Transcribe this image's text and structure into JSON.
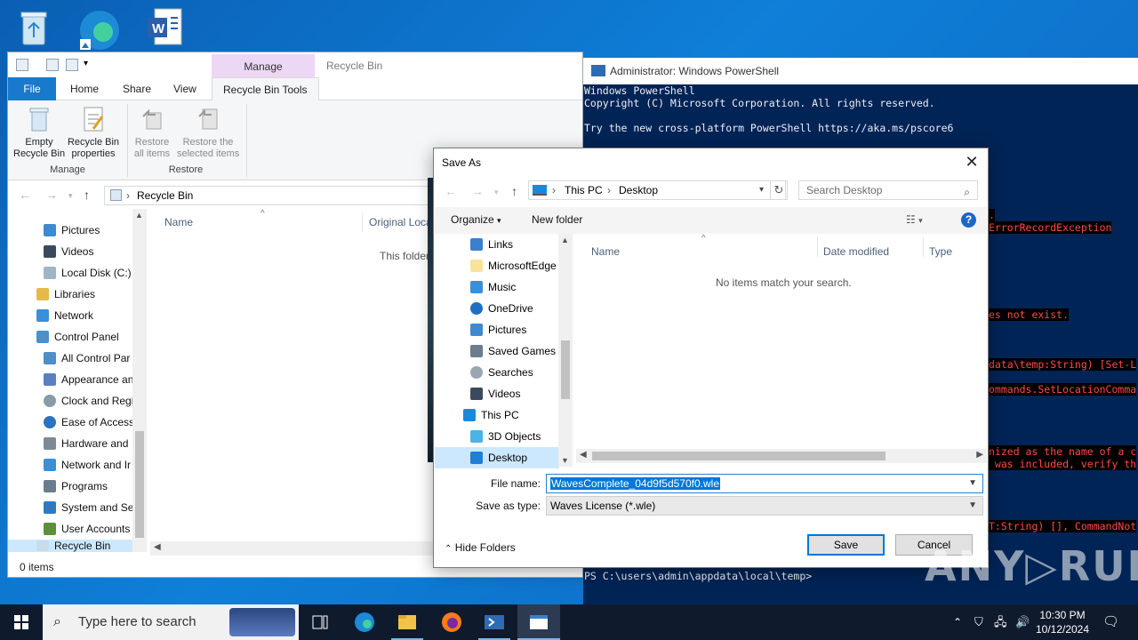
{
  "desktop": {
    "icons": [
      "recycle-bin-icon",
      "edge-icon",
      "word-icon"
    ]
  },
  "explorer": {
    "title": "Recycle Bin",
    "manage_tab": "Manage",
    "tabs": [
      "File",
      "Home",
      "Share",
      "View",
      "Recycle Bin Tools"
    ],
    "ribbon": {
      "empty": "Empty\nRecycle Bin",
      "properties": "Recycle Bin\nproperties",
      "restore_all": "Restore\nall items",
      "restore_selected": "Restore the\nselected items",
      "group_manage": "Manage",
      "group_restore": "Restore"
    },
    "address": "Recycle Bin",
    "tree": [
      "Pictures",
      "Videos",
      "Local Disk (C:)",
      "Libraries",
      "Network",
      "Control Panel",
      "All Control Par",
      "Appearance an",
      "Clock and Regi",
      "Ease of Access",
      "Hardware and",
      "Network and Ir",
      "Programs",
      "System and Se",
      "User Accounts",
      "Recycle Bin"
    ],
    "columns": [
      "Name",
      "Original Loca"
    ],
    "empty_message": "This folder",
    "status": "0 items"
  },
  "powershell": {
    "title": "Administrator: Windows PowerShell",
    "lines": [
      "Windows PowerShell",
      "Copyright (C) Microsoft Corporation. All rights reserved.",
      "",
      "Try the new cross-platform PowerShell https://aka.ms/pscore6"
    ],
    "errors": [
      ".",
      "ErrorRecordException",
      "es not exist.",
      "data\\temp:String) [Set-L",
      "ommands.SetLocationComma",
      "nized as the name of a c",
      " was included, verify th",
      "T:String) [], CommandNot"
    ],
    "prompt": "PS C:\\users\\admin\\appdata\\local\\temp>"
  },
  "dialog": {
    "title": "Save As",
    "breadcrumb": [
      "This PC",
      "Desktop"
    ],
    "search_placeholder": "Search Desktop",
    "organize": "Organize",
    "new_folder": "New folder",
    "tree": [
      "Links",
      "MicrosoftEdge",
      "Music",
      "OneDrive",
      "Pictures",
      "Saved Games",
      "Searches",
      "Videos",
      "This PC",
      "3D Objects",
      "Desktop"
    ],
    "columns": [
      "Name",
      "Date modified",
      "Type"
    ],
    "empty_message": "No items match your search.",
    "file_name_label": "File name:",
    "file_name": "WavesComplete_04d9f5d570f0.wle",
    "save_type_label": "Save as type:",
    "save_type": "Waves License (*.wle)",
    "hide_folders": "Hide Folders",
    "save": "Save",
    "cancel": "Cancel"
  },
  "taskbar": {
    "search_placeholder": "Type here to search",
    "time": "10:30 PM",
    "date": "10/12/2024"
  },
  "watermark": "ANY RUN"
}
